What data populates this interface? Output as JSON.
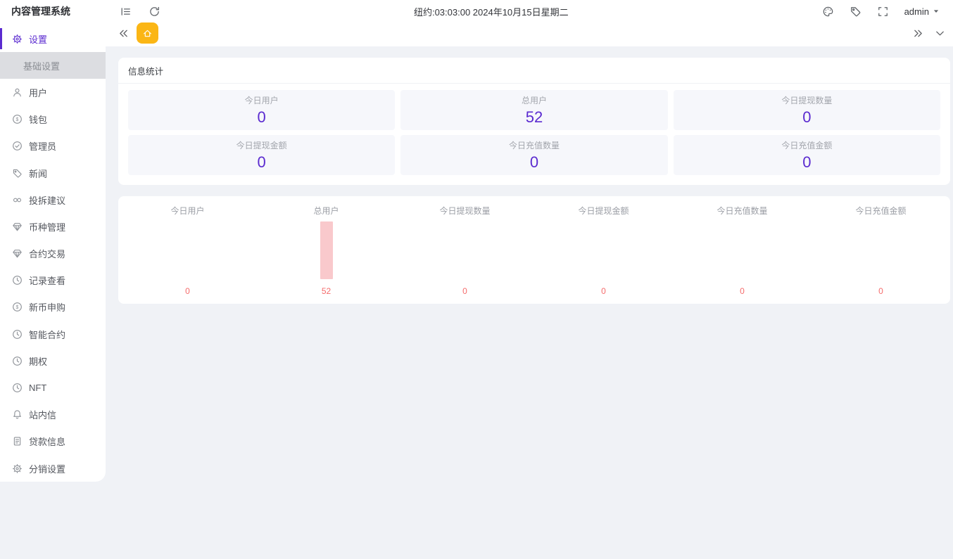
{
  "app_title": "内容管理系统",
  "topbar": {
    "clock_text": "纽约:03:03:00 2024年10月15日星期二",
    "username": "admin"
  },
  "sidebar": {
    "items": [
      {
        "label": "设置",
        "icon": "gear-icon",
        "active": true,
        "children": [
          {
            "label": "基础设置",
            "active": true
          }
        ]
      },
      {
        "label": "用户",
        "icon": "user-icon"
      },
      {
        "label": "钱包",
        "icon": "dollar-circle-icon"
      },
      {
        "label": "管理员",
        "icon": "check-circle-icon"
      },
      {
        "label": "新闻",
        "icon": "tag-icon"
      },
      {
        "label": "投拆建议",
        "icon": "link-icon"
      },
      {
        "label": "币种管理",
        "icon": "gem-icon"
      },
      {
        "label": "合约交易",
        "icon": "gem-icon"
      },
      {
        "label": "记录查看",
        "icon": "clock-icon"
      },
      {
        "label": "新币申购",
        "icon": "dollar-circle-icon"
      },
      {
        "label": "智能合约",
        "icon": "clock-icon"
      },
      {
        "label": "期权",
        "icon": "clock-icon"
      },
      {
        "label": "NFT",
        "icon": "clock-icon"
      },
      {
        "label": "站内信",
        "icon": "bell-icon"
      },
      {
        "label": "贷款信息",
        "icon": "document-icon"
      },
      {
        "label": "分销设置",
        "icon": "gear-icon"
      }
    ]
  },
  "stats": {
    "title": "信息统计",
    "tiles": [
      {
        "label": "今日用户",
        "value": "0"
      },
      {
        "label": "总用户",
        "value": "52"
      },
      {
        "label": "今日提现数量",
        "value": "0"
      },
      {
        "label": "今日提现金额",
        "value": "0"
      },
      {
        "label": "今日充值数量",
        "value": "0"
      },
      {
        "label": "今日充值金额",
        "value": "0"
      }
    ]
  },
  "chart_data": {
    "type": "bar",
    "categories": [
      "今日用户",
      "总用户",
      "今日提现数量",
      "今日提现金额",
      "今日充值数量",
      "今日充值金额"
    ],
    "values": [
      0,
      52,
      0,
      0,
      0,
      0
    ],
    "title": "",
    "xlabel": "",
    "ylabel": "",
    "ylim": [
      0,
      52
    ],
    "grid": false,
    "legend": "none"
  },
  "colors": {
    "accent_purple": "#5b2bd0",
    "tab_home_yellow": "#fbb615",
    "chart_bar_pink": "#f9c9cc",
    "chart_value_red": "#f56c6c",
    "submenu_active_bg": "#dcdde1"
  }
}
